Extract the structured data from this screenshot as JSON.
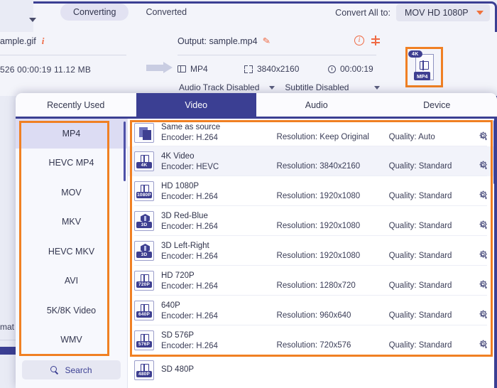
{
  "toolbar": {
    "tabs": [
      {
        "label": "Converting",
        "active": true
      },
      {
        "label": "Converted",
        "active": false
      }
    ],
    "convert_all_label": "Convert All to:",
    "convert_all_value": "MOV HD 1080P"
  },
  "file_row": {
    "source_name": "ample.gif",
    "source_meta": "526  00:00:19  11.12 MB",
    "output_label": "Output: sample.mp4",
    "specs": {
      "format": "MP4",
      "resolution": "3840x2160",
      "duration": "00:00:19"
    },
    "audio_track": "Audio Track Disabled",
    "subtitle": "Subtitle Disabled",
    "thumbnail": {
      "badge_top": "4K",
      "badge_bottom": "MP4"
    }
  },
  "left_stub": "mat",
  "panel": {
    "tabs": [
      {
        "label": "Recently Used",
        "active": false
      },
      {
        "label": "Video",
        "active": true
      },
      {
        "label": "Audio",
        "active": false
      },
      {
        "label": "Device",
        "active": false
      }
    ],
    "sidebar": {
      "items": [
        {
          "label": "MP4",
          "active": true
        },
        {
          "label": "HEVC MP4",
          "active": false
        },
        {
          "label": "MOV",
          "active": false
        },
        {
          "label": "MKV",
          "active": false
        },
        {
          "label": "HEVC MKV",
          "active": false
        },
        {
          "label": "AVI",
          "active": false
        },
        {
          "label": "5K/8K Video",
          "active": false
        },
        {
          "label": "WMV",
          "active": false
        }
      ],
      "search_label": "Search"
    },
    "presets": [
      {
        "title": "Same as source",
        "encoder": "Encoder: H.264",
        "resolution": "Resolution: Keep Original",
        "quality": "Quality: Auto",
        "icon": "stacked-copies-icon",
        "badge": "",
        "selected": false
      },
      {
        "title": "4K Video",
        "encoder": "Encoder: HEVC",
        "resolution": "Resolution: 3840x2160",
        "quality": "Quality: Standard",
        "icon": "film-icon",
        "badge": "4K",
        "selected": true
      },
      {
        "title": "HD 1080P",
        "encoder": "Encoder: H.264",
        "resolution": "Resolution: 1920x1080",
        "quality": "Quality: Standard",
        "icon": "film-icon",
        "badge": "1080P",
        "selected": false
      },
      {
        "title": "3D Red-Blue",
        "encoder": "Encoder: H.264",
        "resolution": "Resolution: 1920x1080",
        "quality": "Quality: Standard",
        "icon": "cube-3d-icon",
        "badge": "3D",
        "selected": false
      },
      {
        "title": "3D Left-Right",
        "encoder": "Encoder: H.264",
        "resolution": "Resolution: 1920x1080",
        "quality": "Quality: Standard",
        "icon": "cube-3d-icon",
        "badge": "3D",
        "selected": false
      },
      {
        "title": "HD 720P",
        "encoder": "Encoder: H.264",
        "resolution": "Resolution: 1280x720",
        "quality": "Quality: Standard",
        "icon": "film-icon",
        "badge": "720P",
        "selected": false
      },
      {
        "title": "640P",
        "encoder": "Encoder: H.264",
        "resolution": "Resolution: 960x640",
        "quality": "Quality: Standard",
        "icon": "film-icon",
        "badge": "640P",
        "selected": false
      },
      {
        "title": "SD 576P",
        "encoder": "Encoder: H.264",
        "resolution": "Resolution: 720x576",
        "quality": "Quality: Standard",
        "icon": "film-icon",
        "badge": "576P",
        "selected": false
      },
      {
        "title": "SD 480P",
        "encoder": "",
        "resolution": "",
        "quality": "",
        "icon": "film-icon",
        "badge": "480P",
        "selected": false
      }
    ]
  },
  "colors": {
    "accent_indigo": "#3b3f93",
    "highlight_orange": "#f08023",
    "orange_text": "#ef6a44",
    "panel_bg": "#f7f8fd"
  }
}
